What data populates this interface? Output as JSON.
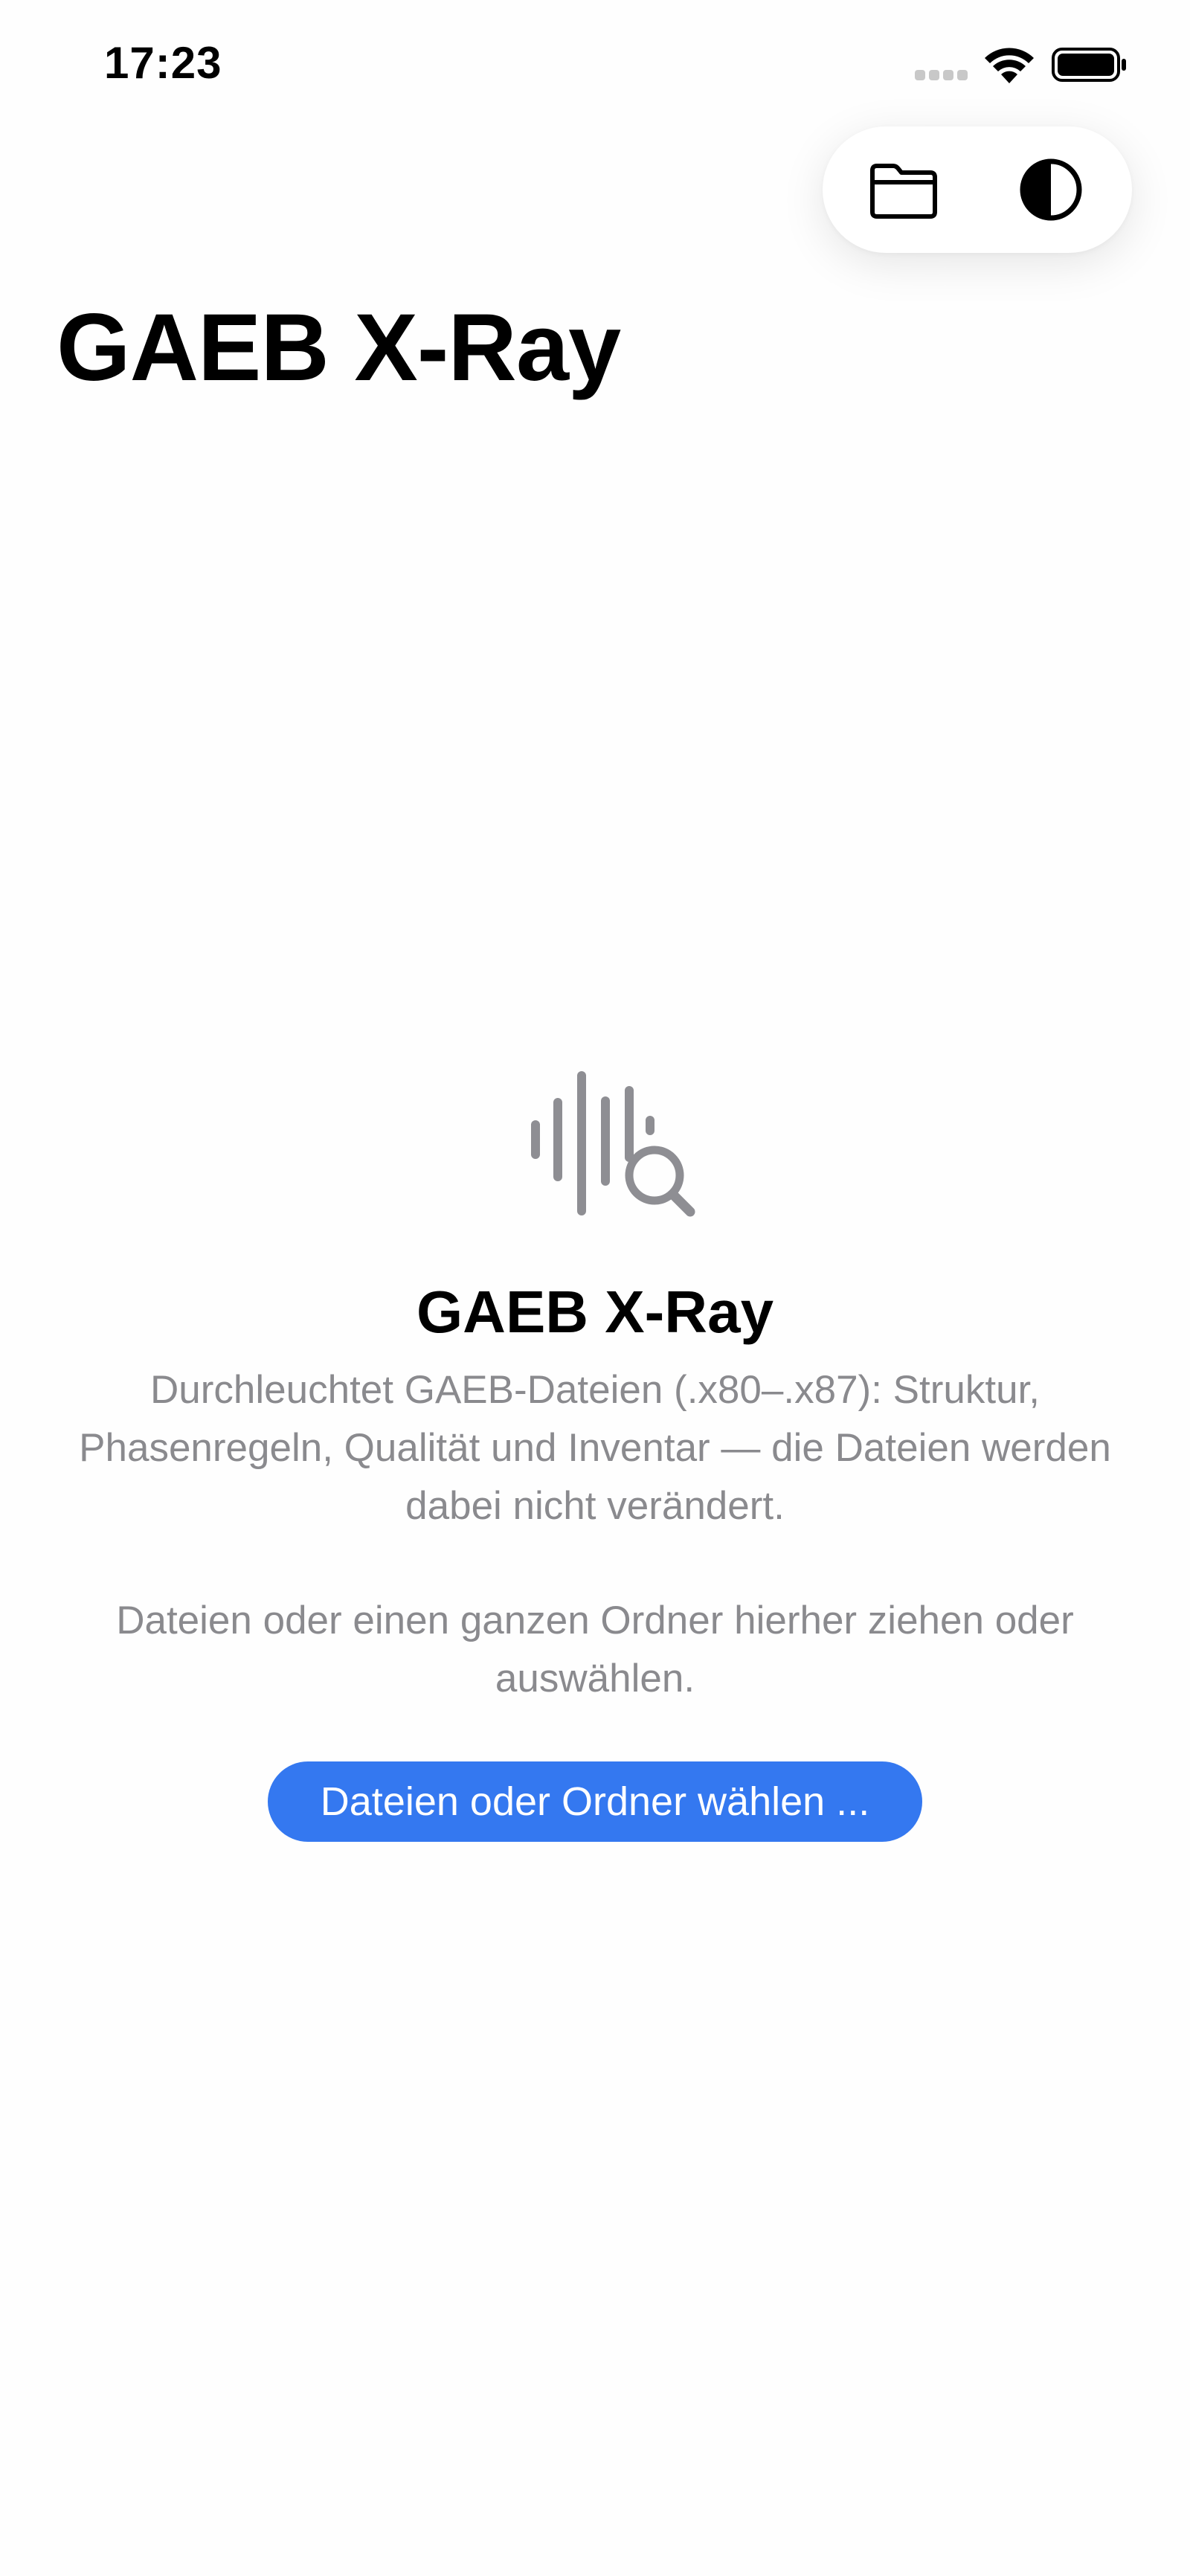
{
  "status_bar": {
    "time": "17:23",
    "icons": [
      "cellular-signal-icon",
      "wifi-icon",
      "battery-icon"
    ]
  },
  "toolbar": {
    "items": [
      {
        "icon": "folder-icon"
      },
      {
        "icon": "contrast-icon"
      }
    ]
  },
  "header": {
    "title": "GAEB X-Ray"
  },
  "empty_state": {
    "icon": "waveform-magnifyingglass-icon",
    "title": "GAEB X-Ray",
    "description": "Durchleuchtet GAEB-Dateien (.x80–.x87): Struktur, Phasenregeln, Qualität und Inventar — die Dateien werden dabei nicht verändert.",
    "hint": "Dateien oder einen ganzen Ordner hierher ziehen oder auswählen.",
    "button_label": "Dateien oder Ordner wählen ..."
  },
  "colors": {
    "accent": "#3478f0",
    "secondary_text": "#8a8a8e",
    "icon_gray": "#8e8e93"
  }
}
